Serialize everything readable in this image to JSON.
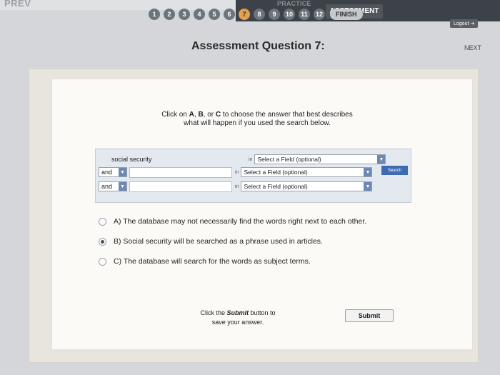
{
  "nav": {
    "prev_label": "PREV",
    "next_label": "NEXT",
    "tab_practice": "PRACTICE",
    "tab_assessment": "ASSESSMENT",
    "logout_label": "Logout",
    "steps": [
      "1",
      "2",
      "3",
      "4",
      "5",
      "6",
      "7",
      "8",
      "9",
      "10",
      "11",
      "12"
    ],
    "active_step": "7",
    "finish_label": "FINISH"
  },
  "page": {
    "title": "Assessment Question 7:"
  },
  "question": {
    "instruction_prefix": "Click on ",
    "opt_a": "A",
    "sep1": ", ",
    "opt_b": "B",
    "sep2": ", or ",
    "opt_c": "C",
    "instruction_suffix": " to choose the answer that best describes",
    "instruction_line2": "what will happen if you used the search below."
  },
  "search": {
    "rows": [
      {
        "term": "social security",
        "bool": "",
        "field": "Select a Field (optional)"
      },
      {
        "term": "",
        "bool": "and",
        "field": "Select a Field (optional)"
      },
      {
        "term": "",
        "bool": "and",
        "field": "Select a Field (optional)"
      }
    ],
    "in_label": "in",
    "search_button": "Search"
  },
  "answers": [
    {
      "text": "A) The database may not necessarily find the words right next to each other.",
      "checked": false
    },
    {
      "text": "B) Social security will be searched as a phrase used in articles.",
      "checked": true
    },
    {
      "text": "C) The database will search for the words as subject terms.",
      "checked": false
    }
  ],
  "submit": {
    "note_prefix": "Click the ",
    "note_keyword": "Submit",
    "note_suffix": " button to",
    "note_line2": "save your answer.",
    "button_label": "Submit"
  }
}
